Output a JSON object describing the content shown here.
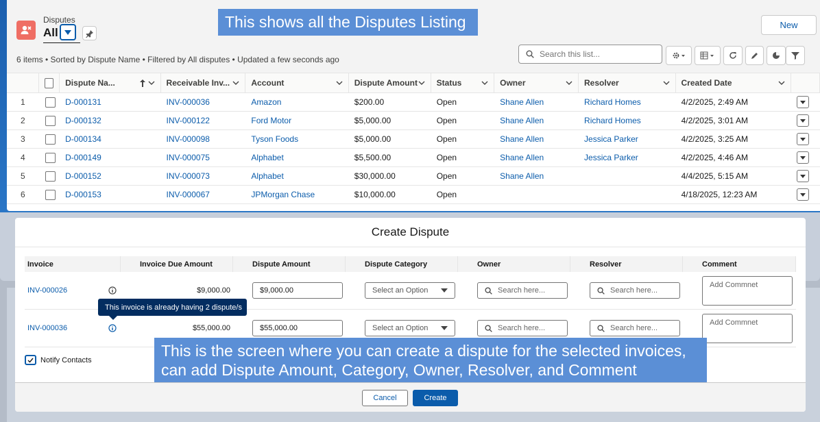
{
  "list": {
    "object_label": "Disputes",
    "view_name": "All",
    "new_label": "New",
    "meta": "6 items • Sorted by Dispute Name • Filtered by All disputes • Updated a few seconds ago",
    "search_placeholder": "Search this list...",
    "columns": [
      "Dispute Na...",
      "Receivable Inv...",
      "Account",
      "Dispute Amount",
      "Status",
      "Owner",
      "Resolver",
      "Created Date"
    ],
    "rows": [
      {
        "num": "1",
        "name": "D-000131",
        "invoice": "INV-000036",
        "account": "Amazon",
        "amount": "$200.00",
        "status": "Open",
        "owner": "Shane Allen",
        "resolver": "Richard Homes",
        "created": "4/2/2025, 2:49 AM"
      },
      {
        "num": "2",
        "name": "D-000132",
        "invoice": "INV-000122",
        "account": "Ford Motor",
        "amount": "$5,000.00",
        "status": "Open",
        "owner": "Shane Allen",
        "resolver": "Richard Homes",
        "created": "4/2/2025, 3:01 AM"
      },
      {
        "num": "3",
        "name": "D-000134",
        "invoice": "INV-000098",
        "account": "Tyson Foods",
        "amount": "$5,000.00",
        "status": "Open",
        "owner": "Shane Allen",
        "resolver": "Jessica Parker",
        "created": "4/2/2025, 3:25 AM"
      },
      {
        "num": "4",
        "name": "D-000149",
        "invoice": "INV-000075",
        "account": "Alphabet",
        "amount": "$5,500.00",
        "status": "Open",
        "owner": "Shane Allen",
        "resolver": "Jessica Parker",
        "created": "4/2/2025, 4:46 AM"
      },
      {
        "num": "5",
        "name": "D-000152",
        "invoice": "INV-000073",
        "account": "Alphabet",
        "amount": "$30,000.00",
        "status": "Open",
        "owner": "Shane Allen",
        "resolver": "",
        "created": "4/4/2025, 5:15 AM"
      },
      {
        "num": "6",
        "name": "D-000153",
        "invoice": "INV-000067",
        "account": "JPMorgan Chase",
        "amount": "$10,000.00",
        "status": "Open",
        "owner": "",
        "resolver": "",
        "created": "4/18/2025, 12:23 AM"
      }
    ]
  },
  "callouts": {
    "top": "This shows all the Disputes Listing",
    "bottom": "This is the screen where you can create a dispute for the selected invoices, can add Dispute Amount, Category, Owner, Resolver, and Comment"
  },
  "modal": {
    "title": "Create Dispute",
    "columns": [
      "Invoice",
      "Invoice Due Amount",
      "Dispute Amount",
      "Dispute Category",
      "Owner",
      "Resolver",
      "Comment"
    ],
    "rows": [
      {
        "invoice": "INV-000026",
        "due": "$9,000.00",
        "amount": "$9,000.00",
        "category_placeholder": "Select an Option",
        "owner_placeholder": "Search here...",
        "resolver_placeholder": "Search here...",
        "comment_placeholder": "Add Commnet"
      },
      {
        "invoice": "INV-000036",
        "due": "$55,000.00",
        "amount": "$55,000.00",
        "category_placeholder": "Select an Option",
        "owner_placeholder": "Search here...",
        "resolver_placeholder": "Search here...",
        "comment_placeholder": "Add Commnet"
      }
    ],
    "tooltip": "This invoice is already having 2 dispute/s",
    "notify_label": "Notify Contacts",
    "notify_checked": true,
    "cancel_label": "Cancel",
    "create_label": "Create"
  },
  "colors": {
    "brand": "#0b5cab",
    "object_icon": "#ef6e64",
    "callout": "#5b8fd6",
    "tooltip": "#032d60"
  }
}
